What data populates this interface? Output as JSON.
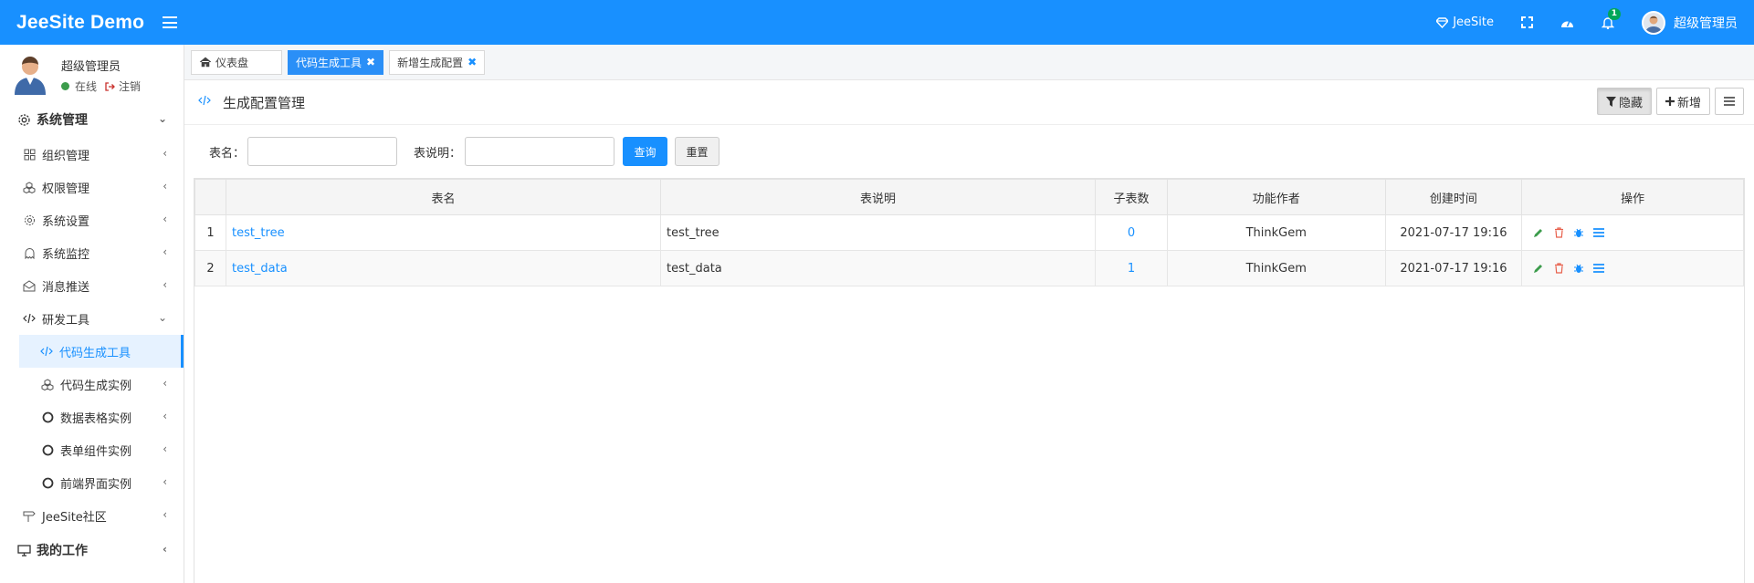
{
  "app": {
    "title": "JeeSite Demo"
  },
  "topbar": {
    "jeesite_label": "JeeSite",
    "notification_count": "1",
    "user_name": "超级管理员"
  },
  "sidebar": {
    "user": {
      "name": "超级管理员",
      "status": "在线",
      "logout": "注销"
    },
    "sections": [
      {
        "label": "系统管理"
      },
      {
        "label": "我的工作"
      }
    ],
    "items": [
      {
        "label": "组织管理"
      },
      {
        "label": "权限管理"
      },
      {
        "label": "系统设置"
      },
      {
        "label": "系统监控"
      },
      {
        "label": "消息推送"
      },
      {
        "label": "研发工具"
      },
      {
        "label": "代码生成工具"
      },
      {
        "label": "代码生成实例"
      },
      {
        "label": "数据表格实例"
      },
      {
        "label": "表单组件实例"
      },
      {
        "label": "前端界面实例"
      },
      {
        "label": "JeeSite社区"
      }
    ]
  },
  "tabs": [
    {
      "label": "仪表盘"
    },
    {
      "label": "代码生成工具"
    },
    {
      "label": "新增生成配置"
    }
  ],
  "page": {
    "title": "生成配置管理",
    "hide_label": "隐藏",
    "add_label": "新增"
  },
  "search": {
    "table_name_label": "表名：",
    "table_desc_label": "表说明：",
    "query_label": "查询",
    "reset_label": "重置"
  },
  "table": {
    "columns": [
      "表名",
      "表说明",
      "子表数",
      "功能作者",
      "创建时间",
      "操作"
    ],
    "rows": [
      {
        "index": "1",
        "name": "test_tree",
        "desc": "test_tree",
        "children": "0",
        "author": "ThinkGem",
        "created": "2021-07-17 19:16"
      },
      {
        "index": "2",
        "name": "test_data",
        "desc": "test_data",
        "children": "1",
        "author": "ThinkGem",
        "created": "2021-07-17 19:16"
      }
    ]
  },
  "colors": {
    "primary": "#1890ff",
    "edit": "#3c9c4c",
    "delete": "#e8604c"
  }
}
